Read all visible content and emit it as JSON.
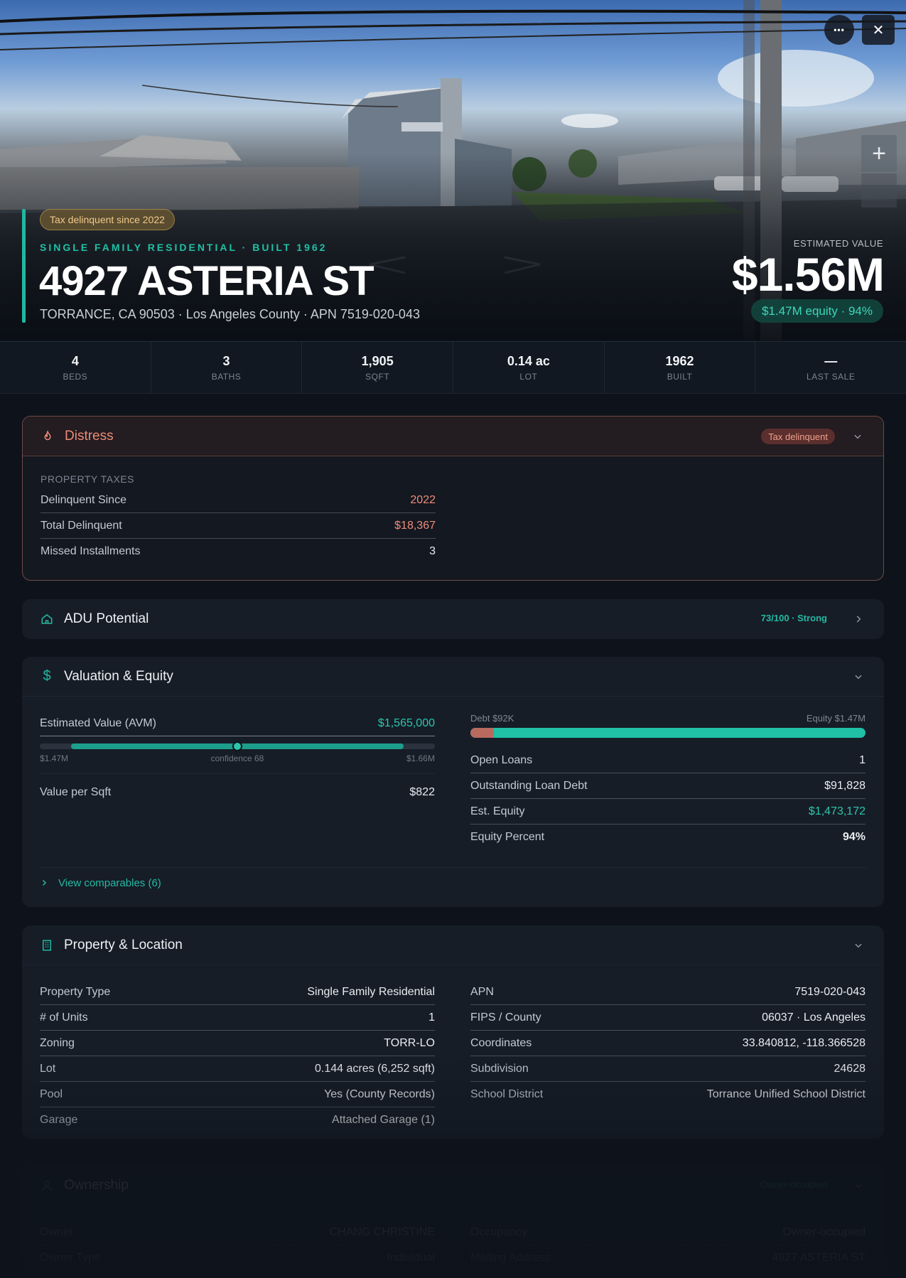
{
  "hero": {
    "tax_pill": "Tax delinquent since 2022",
    "subtitle": "SINGLE FAMILY RESIDENTIAL · BUILT 1962",
    "title": "4927 ASTERIA ST",
    "address": "TORRANCE, CA 90503 · Los Angeles County · APN 7519-020-043",
    "est_label": "ESTIMATED VALUE",
    "est_value": "$1.56M",
    "equity_pill": "$1.47M equity · 94%",
    "more_glyph": "•••",
    "close_glyph": "✕",
    "zoom_glyph": "+"
  },
  "stats": [
    {
      "value": "4",
      "label": "BEDS"
    },
    {
      "value": "3",
      "label": "BATHS"
    },
    {
      "value": "1,905",
      "label": "SQFT"
    },
    {
      "value": "0.14 ac",
      "label": "LOT"
    },
    {
      "value": "1962",
      "label": "BUILT"
    },
    {
      "value": "—",
      "label": "LAST SALE"
    }
  ],
  "distress": {
    "title": "Distress",
    "badge": "Tax delinquent",
    "section": "PROPERTY TAXES",
    "rows": [
      {
        "k": "Delinquent Since",
        "v": "2022"
      },
      {
        "k": "Total Delinquent",
        "v": "$18,367"
      },
      {
        "k": "Missed Installments",
        "v": "3"
      }
    ]
  },
  "adu": {
    "title": "ADU Potential",
    "score": "73/100 · Strong"
  },
  "valuation": {
    "title": "Valuation & Equity",
    "avm_label": "Estimated Value (AVM)",
    "avm_value": "$1,565,000",
    "range_low": "$1.47M",
    "range_mid": "confidence 68",
    "range_high": "$1.66M",
    "range_fill_start": 0.08,
    "range_fill_end": 0.92,
    "range_knob": 0.5,
    "vps_label": "Value per Sqft",
    "vps_value": "$822",
    "debt_label": "Debt $92K",
    "equity_label": "Equity $1.47M",
    "debt_fraction": 0.06,
    "loan_rows": [
      {
        "k": "Open Loans",
        "v": "1"
      },
      {
        "k": "Outstanding Loan Debt",
        "v": "$91,828"
      },
      {
        "k": "Est. Equity",
        "v": "$1,473,172"
      },
      {
        "k": "Equity Percent",
        "v": "94%"
      }
    ],
    "comps_link": "View comparables (6)"
  },
  "property": {
    "title": "Property & Location",
    "left": [
      {
        "k": "Property Type",
        "v": "Single Family Residential"
      },
      {
        "k": "# of Units",
        "v": "1"
      },
      {
        "k": "Zoning",
        "v": "TORR-LO"
      },
      {
        "k": "Lot",
        "v": "0.144 acres (6,252 sqft)"
      },
      {
        "k": "Pool",
        "v": "Yes (County Records)"
      },
      {
        "k": "Garage",
        "v": "Attached Garage (1)"
      }
    ],
    "right": [
      {
        "k": "APN",
        "v": "7519-020-043"
      },
      {
        "k": "FIPS / County",
        "v": "06037 · Los Angeles"
      },
      {
        "k": "Coordinates",
        "v": "33.840812, -118.366528"
      },
      {
        "k": "Subdivision",
        "v": "24628"
      },
      {
        "k": "School District",
        "v": "Torrance Unified School District"
      }
    ]
  },
  "ownership": {
    "title": "Ownership",
    "badge": "Owner-occupied",
    "left": [
      {
        "k": "Owner",
        "v": "CHANG CHRISTINE"
      },
      {
        "k": "Owner Type",
        "v": "Individual"
      }
    ],
    "right": [
      {
        "k": "Occupancy",
        "v": "Owner-occupied"
      },
      {
        "k": "Mailing Address",
        "v": "4927 ASTERIA ST"
      }
    ]
  },
  "colors": {
    "accent": "#21b8a1",
    "danger": "#ee8c78",
    "background": "#0e131b",
    "card": "#161d27"
  }
}
